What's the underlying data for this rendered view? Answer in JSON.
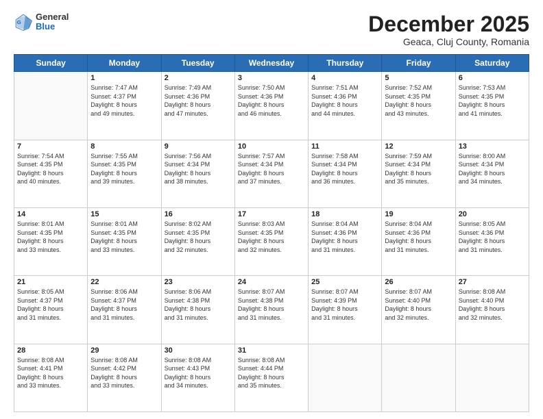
{
  "header": {
    "logo_general": "General",
    "logo_blue": "Blue",
    "month_title": "December 2025",
    "subtitle": "Geaca, Cluj County, Romania"
  },
  "weekdays": [
    "Sunday",
    "Monday",
    "Tuesday",
    "Wednesday",
    "Thursday",
    "Friday",
    "Saturday"
  ],
  "weeks": [
    [
      {
        "day": "",
        "info": ""
      },
      {
        "day": "1",
        "info": "Sunrise: 7:47 AM\nSunset: 4:37 PM\nDaylight: 8 hours\nand 49 minutes."
      },
      {
        "day": "2",
        "info": "Sunrise: 7:49 AM\nSunset: 4:36 PM\nDaylight: 8 hours\nand 47 minutes."
      },
      {
        "day": "3",
        "info": "Sunrise: 7:50 AM\nSunset: 4:36 PM\nDaylight: 8 hours\nand 46 minutes."
      },
      {
        "day": "4",
        "info": "Sunrise: 7:51 AM\nSunset: 4:36 PM\nDaylight: 8 hours\nand 44 minutes."
      },
      {
        "day": "5",
        "info": "Sunrise: 7:52 AM\nSunset: 4:35 PM\nDaylight: 8 hours\nand 43 minutes."
      },
      {
        "day": "6",
        "info": "Sunrise: 7:53 AM\nSunset: 4:35 PM\nDaylight: 8 hours\nand 41 minutes."
      }
    ],
    [
      {
        "day": "7",
        "info": "Sunrise: 7:54 AM\nSunset: 4:35 PM\nDaylight: 8 hours\nand 40 minutes."
      },
      {
        "day": "8",
        "info": "Sunrise: 7:55 AM\nSunset: 4:35 PM\nDaylight: 8 hours\nand 39 minutes."
      },
      {
        "day": "9",
        "info": "Sunrise: 7:56 AM\nSunset: 4:34 PM\nDaylight: 8 hours\nand 38 minutes."
      },
      {
        "day": "10",
        "info": "Sunrise: 7:57 AM\nSunset: 4:34 PM\nDaylight: 8 hours\nand 37 minutes."
      },
      {
        "day": "11",
        "info": "Sunrise: 7:58 AM\nSunset: 4:34 PM\nDaylight: 8 hours\nand 36 minutes."
      },
      {
        "day": "12",
        "info": "Sunrise: 7:59 AM\nSunset: 4:34 PM\nDaylight: 8 hours\nand 35 minutes."
      },
      {
        "day": "13",
        "info": "Sunrise: 8:00 AM\nSunset: 4:34 PM\nDaylight: 8 hours\nand 34 minutes."
      }
    ],
    [
      {
        "day": "14",
        "info": "Sunrise: 8:01 AM\nSunset: 4:35 PM\nDaylight: 8 hours\nand 33 minutes."
      },
      {
        "day": "15",
        "info": "Sunrise: 8:01 AM\nSunset: 4:35 PM\nDaylight: 8 hours\nand 33 minutes."
      },
      {
        "day": "16",
        "info": "Sunrise: 8:02 AM\nSunset: 4:35 PM\nDaylight: 8 hours\nand 32 minutes."
      },
      {
        "day": "17",
        "info": "Sunrise: 8:03 AM\nSunset: 4:35 PM\nDaylight: 8 hours\nand 32 minutes."
      },
      {
        "day": "18",
        "info": "Sunrise: 8:04 AM\nSunset: 4:36 PM\nDaylight: 8 hours\nand 31 minutes."
      },
      {
        "day": "19",
        "info": "Sunrise: 8:04 AM\nSunset: 4:36 PM\nDaylight: 8 hours\nand 31 minutes."
      },
      {
        "day": "20",
        "info": "Sunrise: 8:05 AM\nSunset: 4:36 PM\nDaylight: 8 hours\nand 31 minutes."
      }
    ],
    [
      {
        "day": "21",
        "info": "Sunrise: 8:05 AM\nSunset: 4:37 PM\nDaylight: 8 hours\nand 31 minutes."
      },
      {
        "day": "22",
        "info": "Sunrise: 8:06 AM\nSunset: 4:37 PM\nDaylight: 8 hours\nand 31 minutes."
      },
      {
        "day": "23",
        "info": "Sunrise: 8:06 AM\nSunset: 4:38 PM\nDaylight: 8 hours\nand 31 minutes."
      },
      {
        "day": "24",
        "info": "Sunrise: 8:07 AM\nSunset: 4:38 PM\nDaylight: 8 hours\nand 31 minutes."
      },
      {
        "day": "25",
        "info": "Sunrise: 8:07 AM\nSunset: 4:39 PM\nDaylight: 8 hours\nand 31 minutes."
      },
      {
        "day": "26",
        "info": "Sunrise: 8:07 AM\nSunset: 4:40 PM\nDaylight: 8 hours\nand 32 minutes."
      },
      {
        "day": "27",
        "info": "Sunrise: 8:08 AM\nSunset: 4:40 PM\nDaylight: 8 hours\nand 32 minutes."
      }
    ],
    [
      {
        "day": "28",
        "info": "Sunrise: 8:08 AM\nSunset: 4:41 PM\nDaylight: 8 hours\nand 33 minutes."
      },
      {
        "day": "29",
        "info": "Sunrise: 8:08 AM\nSunset: 4:42 PM\nDaylight: 8 hours\nand 33 minutes."
      },
      {
        "day": "30",
        "info": "Sunrise: 8:08 AM\nSunset: 4:43 PM\nDaylight: 8 hours\nand 34 minutes."
      },
      {
        "day": "31",
        "info": "Sunrise: 8:08 AM\nSunset: 4:44 PM\nDaylight: 8 hours\nand 35 minutes."
      },
      {
        "day": "",
        "info": ""
      },
      {
        "day": "",
        "info": ""
      },
      {
        "day": "",
        "info": ""
      }
    ]
  ]
}
